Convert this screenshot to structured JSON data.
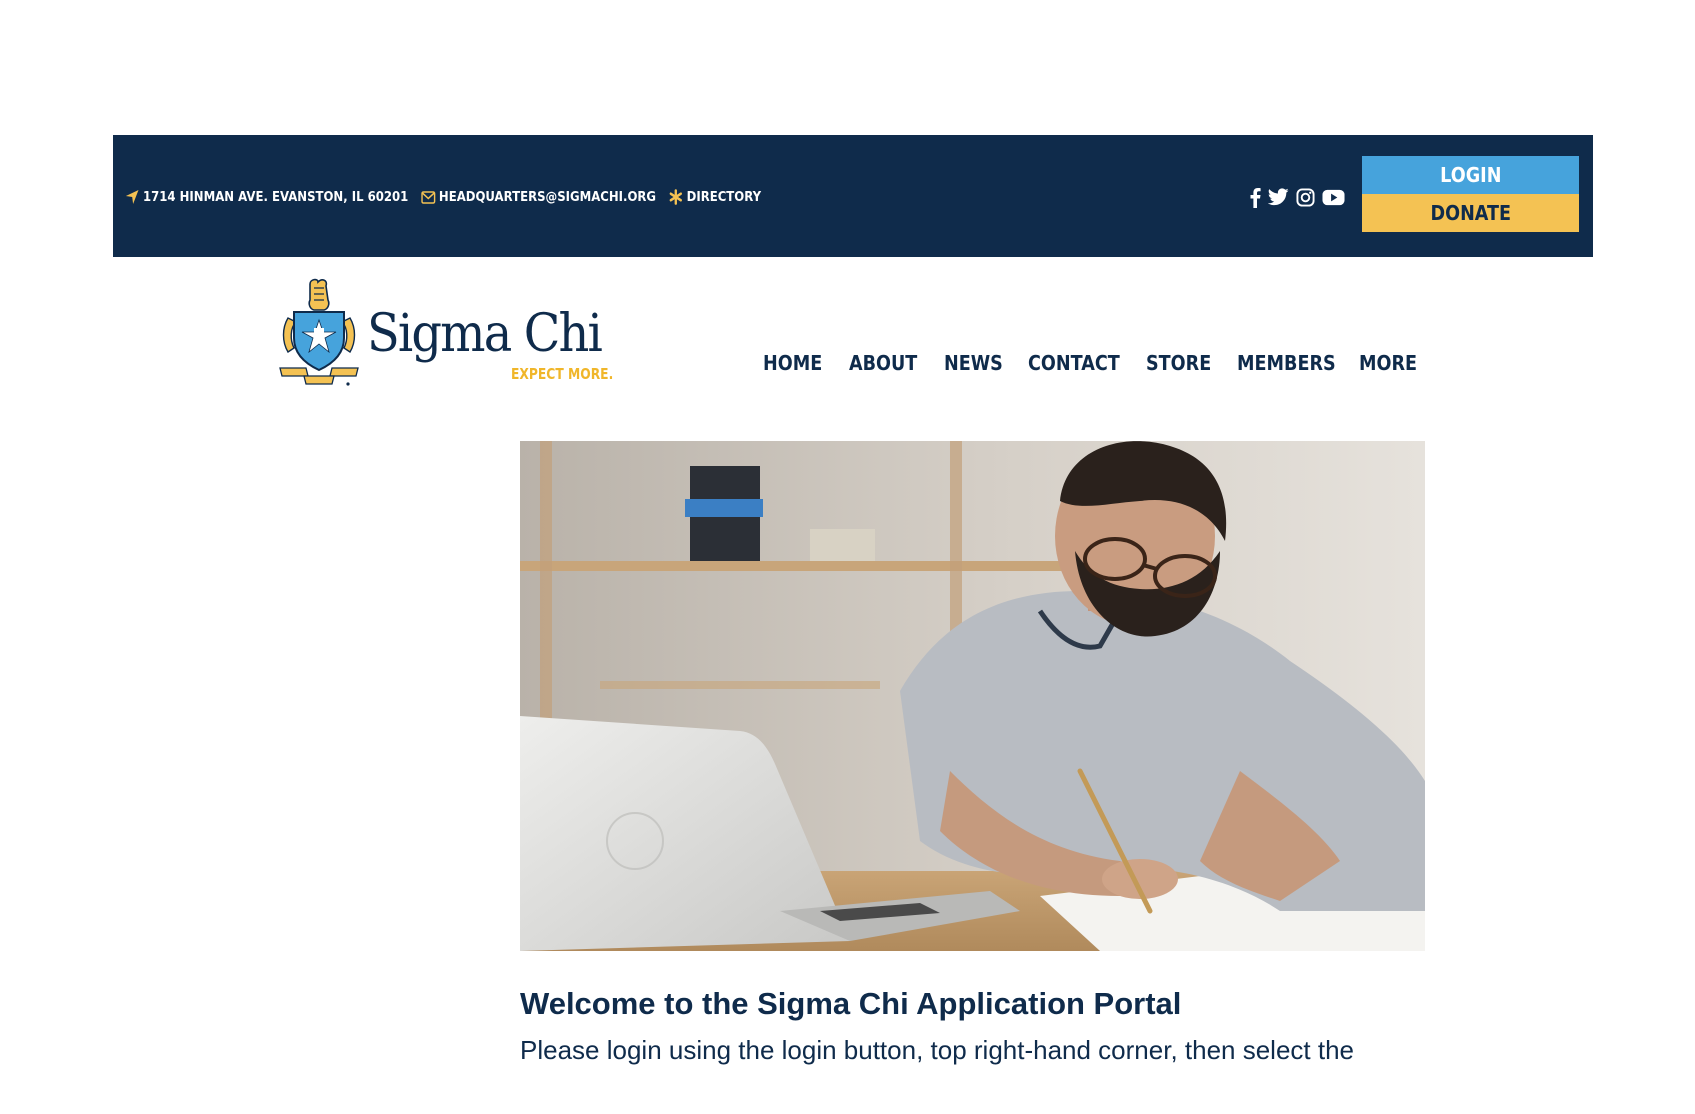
{
  "topbar": {
    "address": "1714 HINMAN AVE. EVANSTON, IL 60201",
    "email": "HEADQUARTERS@SIGMACHI.ORG",
    "directory": "DIRECTORY",
    "social_icons": [
      "facebook-icon",
      "twitter-icon",
      "instagram-icon",
      "youtube-icon"
    ],
    "login_label": "LOGIN",
    "donate_label": "DONATE"
  },
  "logo": {
    "title": "Sigma Chi",
    "tagline": "EXPECT MORE."
  },
  "nav": {
    "items": [
      "HOME",
      "ABOUT",
      "NEWS",
      "CONTACT",
      "STORE",
      "MEMBERS",
      "MORE"
    ]
  },
  "main": {
    "heading": "Welcome to the Sigma Chi Application Portal",
    "intro": "Please login using the login button, top right-hand corner, then select the"
  },
  "colors": {
    "navy": "#0f2b4b",
    "login_blue": "#46a3dc",
    "donate_gold": "#f4c253",
    "accent_gold": "#f0b62a"
  }
}
